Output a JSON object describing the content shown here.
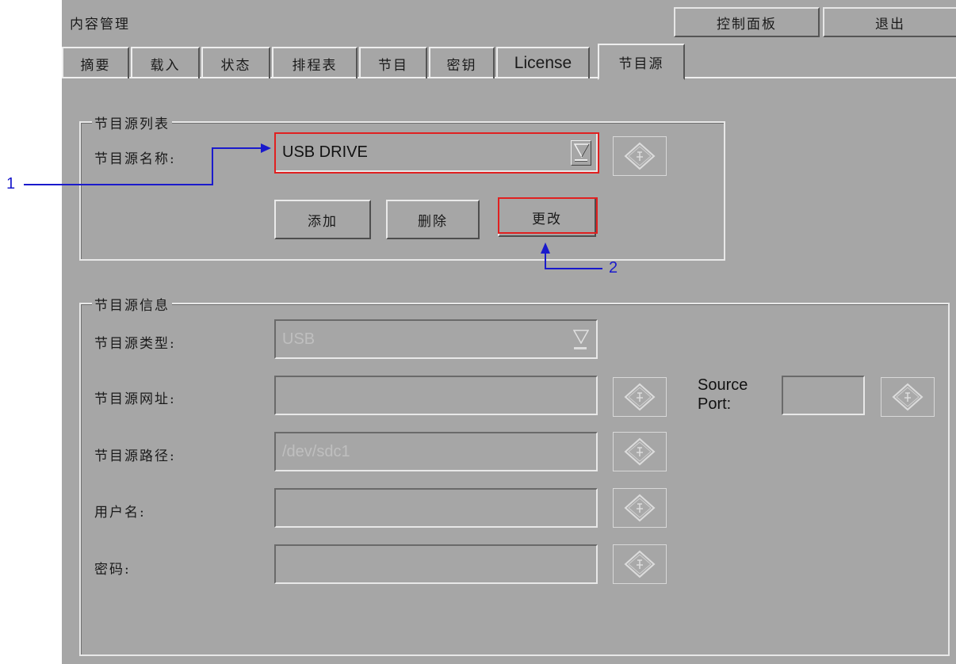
{
  "app": {
    "title": "内容管理",
    "control_panel_label": "控制面板",
    "exit_label": "退出"
  },
  "tabs": [
    {
      "label": "摘要",
      "active": false
    },
    {
      "label": "载入",
      "active": false
    },
    {
      "label": "状态",
      "active": false
    },
    {
      "label": "排程表",
      "active": false
    },
    {
      "label": "节目",
      "active": false
    },
    {
      "label": "密钥",
      "active": false
    },
    {
      "label": "License",
      "active": false
    },
    {
      "label": "节目源",
      "active": true
    }
  ],
  "source_list": {
    "legend": "节目源列表",
    "name_label": "节目源名称:",
    "name_value": "USB DRIVE",
    "add_label": "添加",
    "delete_label": "删除",
    "change_label": "更改"
  },
  "source_info": {
    "legend": "节目源信息",
    "type_label": "节目源类型:",
    "type_value": "USB",
    "url_label": "节目源网址:",
    "url_value": "",
    "port_label_line1": "Source",
    "port_label_line2": "Port:",
    "port_value": "",
    "path_label": "节目源路径:",
    "path_value": "/dev/sdc1",
    "user_label": "用户名:",
    "user_value": "",
    "password_label": "密码:",
    "password_value": ""
  },
  "callouts": {
    "one": "1",
    "two": "2"
  },
  "colors": {
    "panel": "#a6a6a6",
    "highlight": "#e02020",
    "callout": "#1a1acc"
  }
}
